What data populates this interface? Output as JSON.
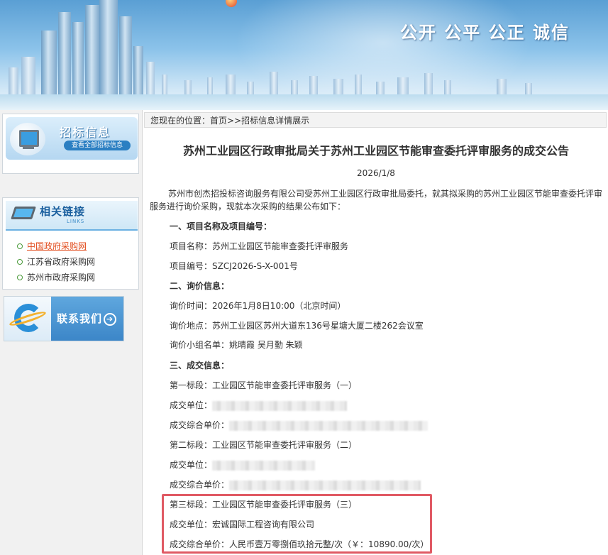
{
  "banner": {
    "slogan": "公开 公平 公正 诚信"
  },
  "sidebar": {
    "bid_info": {
      "title": "招标信息",
      "button": "查看全部招标信息"
    },
    "links": {
      "title": "相关链接",
      "subtitle": "LINKS",
      "items": [
        {
          "label": "中国政府采购网",
          "active": true
        },
        {
          "label": "江苏省政府采购网",
          "active": false
        },
        {
          "label": "苏州市政府采购网",
          "active": false
        }
      ]
    },
    "contact": {
      "label": "联系我们",
      "arrow": "➔"
    }
  },
  "breadcrumb": {
    "prefix": "您现在的位置：",
    "home": "首页",
    "sep": ">>",
    "current": "招标信息详情展示"
  },
  "article": {
    "title": "苏州工业园区行政审批局关于苏州工业园区节能审查委托评审服务的成交公告",
    "date": "2026/1/8",
    "intro": "苏州市创杰招投标咨询服务有限公司受苏州工业园区行政审批局委托，就其拟采购的苏州工业园区节能审查委托评审服务进行询价采购，现就本次采购的结果公布如下：",
    "section1": "一、项目名称及项目编号：",
    "project_name": "项目名称：苏州工业园区节能审查委托评审服务",
    "project_no": "项目编号：SZCJ2026-S-X-001号",
    "section2": "二、询价信息：",
    "inquiry_time": "询价时间：2026年1月8日10:00（北京时间）",
    "inquiry_place": "询价地点：苏州工业园区苏州大道东136号星塘大厦二楼262会议室",
    "inquiry_group": "询价小组名单：姚晴霞  吴月勤  朱颖",
    "section3": "三、成交信息：",
    "lot1_title": "第一标段：工业园区节能审查委托评审服务（一）",
    "lot1_winner_label": "成交单位：",
    "lot1_price_label": "成交综合单价：",
    "lot2_title": "第二标段：工业园区节能审查委托评审服务（二）",
    "lot2_winner_label": "成交单位：",
    "lot2_price_label": "成交综合单价：",
    "lot3_title": "第三标段：工业园区节能审查委托评审服务（三）",
    "lot3_winner": "成交单位：宏诚国际工程咨询有限公司",
    "lot3_price": "成交综合单价：人民币壹万零捌佰玖拾元整/次（￥：10890.00/次）"
  },
  "colors": {
    "highlight_border": "#e05a64",
    "active_link": "#e24a1a",
    "banner_sky": "#5a9fd4"
  }
}
